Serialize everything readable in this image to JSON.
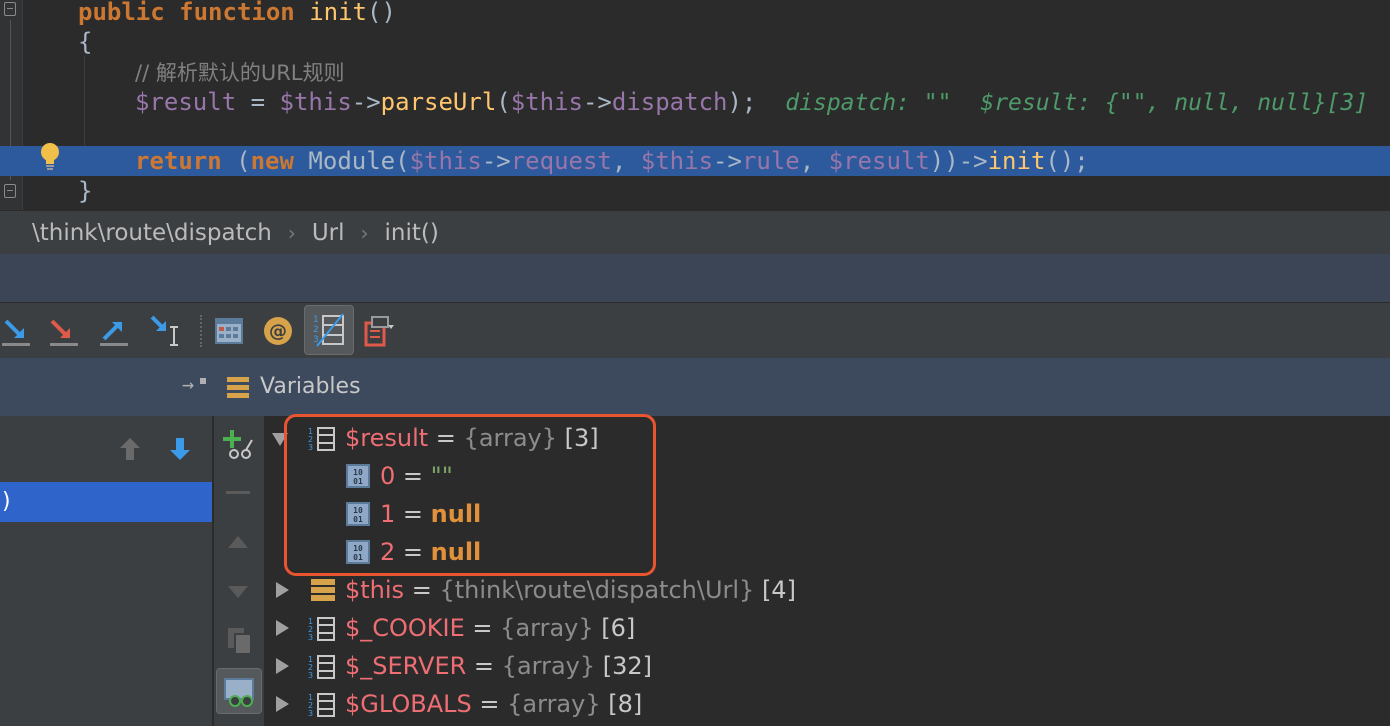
{
  "editor": {
    "line1": {
      "kw1": "public",
      "kw2": "function",
      "fn": "init",
      "paren": "()"
    },
    "line2": "{",
    "comment": "// 解析默认的URL规则",
    "line4": {
      "var_result": "$result",
      "op_assign": " = ",
      "var_this": "$this",
      "arrow": "->",
      "method": "parseUrl",
      "open": "(",
      "arg_this": "$this",
      "arg_arrow": "->",
      "arg_prop": "dispatch",
      "close": ");",
      "inlay1": "dispatch: \"\"",
      "inlay2": "$result: {\"\", null, null}[3]"
    },
    "line6": {
      "kw_return": "return",
      "open": " (",
      "kw_new": "new",
      "class": " Module(",
      "this1": "$this",
      "arrow1": "->",
      "prop1": "request",
      "comma1": ", ",
      "this2": "$this",
      "arrow2": "->",
      "prop2": "rule",
      "comma2": ", ",
      "res": "$result",
      "close": "))",
      "arrow3": "->",
      "init": "init",
      "end": "();"
    },
    "line7": "}"
  },
  "breadcrumb": {
    "items": [
      "\\think\\route\\dispatch",
      "Url",
      "init()"
    ],
    "separator": "›"
  },
  "toolbar": {
    "icons": [
      "step-over-icon",
      "step-into-icon",
      "force-step-into-icon",
      "step-out-icon",
      "run-to-cursor-icon",
      "evaluate-expression-icon",
      "toggle-watches-icon",
      "show-values-icon",
      "restore-layout-icon"
    ]
  },
  "variables_panel": {
    "title": "Variables",
    "pin_glyph": "→"
  },
  "frames": {
    "selected_label": ")"
  },
  "tree": {
    "rows": [
      {
        "name": "$result",
        "eq": " = ",
        "type": "{array}",
        "count": " [3]",
        "expanded": true
      },
      {
        "name": "0",
        "eq": " = ",
        "value": "\"\""
      },
      {
        "name": "1",
        "eq": " = ",
        "value": "null"
      },
      {
        "name": "2",
        "eq": " = ",
        "value": "null"
      },
      {
        "name": "$this",
        "eq": " = ",
        "type": "{think\\route\\dispatch\\Url}",
        "count": " [4]",
        "expanded": false
      },
      {
        "name": "$_COOKIE",
        "eq": " = ",
        "type": "{array}",
        "count": " [6]",
        "expanded": false
      },
      {
        "name": "$_SERVER",
        "eq": " = ",
        "type": "{array}",
        "count": " [32]",
        "expanded": false
      },
      {
        "name": "$GLOBALS",
        "eq": " = ",
        "type": "{array}",
        "count": " [8]",
        "expanded": false
      }
    ]
  },
  "colors": {
    "highlight_box": "#e8552f",
    "selected_line": "#2d5a9c",
    "selected_frame": "#2f65ca"
  }
}
